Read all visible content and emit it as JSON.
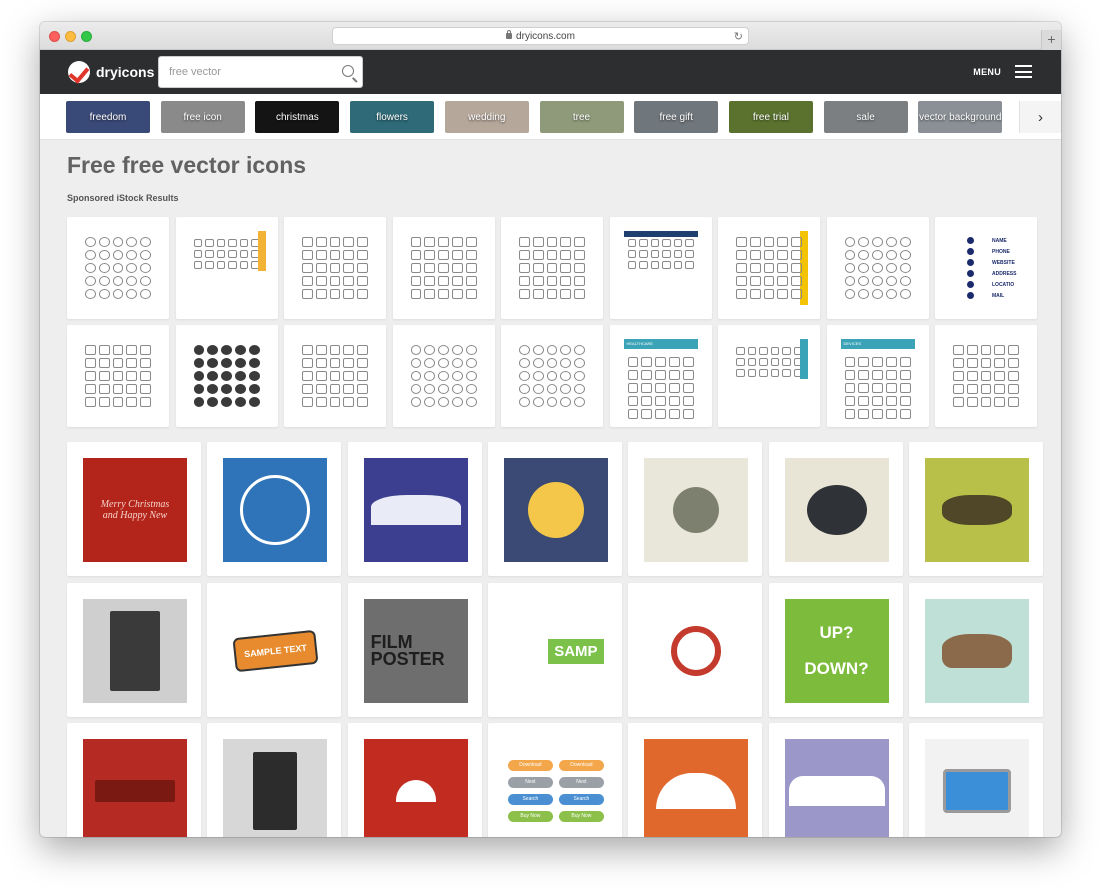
{
  "browser": {
    "url": "dryicons.com"
  },
  "header": {
    "logo_text": "dryicons",
    "search_placeholder": "free vector",
    "menu_label": "MENU"
  },
  "tags": [
    {
      "label": "freedom",
      "color": "#3a4a78"
    },
    {
      "label": "free icon",
      "color": "#8a8a8a"
    },
    {
      "label": "christmas",
      "color": "#141414"
    },
    {
      "label": "flowers",
      "color": "#2e6a77"
    },
    {
      "label": "wedding",
      "color": "#b5a79a"
    },
    {
      "label": "tree",
      "color": "#8f9a7a"
    },
    {
      "label": "free gift",
      "color": "#70777c"
    },
    {
      "label": "free trial",
      "color": "#5a722e"
    },
    {
      "label": "sale",
      "color": "#7b7f82"
    },
    {
      "label": "vector background",
      "color": "#8a9096"
    }
  ],
  "tags_next_icon": "chevron-right-icon",
  "main": {
    "title": "Free free vector icons",
    "sponsored_label": "Sponsored iStock Results"
  },
  "sponsored_cards": {
    "row1": [
      {
        "style": "round",
        "icon": "globe-icons"
      },
      {
        "style": "small",
        "icon": "weather-icons",
        "accent": "#f2b233"
      },
      {
        "style": "line",
        "icon": "presentation-icons"
      },
      {
        "style": "line",
        "icon": "people-icons"
      },
      {
        "style": "line",
        "icon": "search-icons"
      },
      {
        "style": "small",
        "icon": "infographic-icons",
        "accent": "#1f3f6e"
      },
      {
        "style": "line",
        "icon": "business-icons",
        "accent": "#f3c200"
      },
      {
        "style": "round",
        "icon": "rocket-icons"
      },
      {
        "style": "contact",
        "icon": "contact-icons",
        "labels": [
          "NAME",
          "PHONE",
          "WEBSITE",
          "ADDRESS",
          "LOCATIO",
          "MAIL"
        ]
      }
    ],
    "row2": [
      {
        "style": "line",
        "icon": "document-icons"
      },
      {
        "style": "solid",
        "icon": "clock-icons"
      },
      {
        "style": "line",
        "icon": "family-icons"
      },
      {
        "style": "round",
        "icon": "thumbs-icons"
      },
      {
        "style": "round",
        "icon": "alarm-icons"
      },
      {
        "style": "line",
        "icon": "healthcare-icons",
        "header": "HEALTHCARE",
        "accent": "#3aa3b8"
      },
      {
        "style": "small",
        "icon": "media-icons",
        "accent": "#3aa3b8"
      },
      {
        "style": "line",
        "icon": "devices-icons",
        "header": "DEVICES",
        "accent": "#3aa3b8"
      },
      {
        "style": "line",
        "icon": "misc-icons"
      }
    ]
  },
  "vector_cards": {
    "row1": [
      {
        "name": "christmas-ornament-vector",
        "text": "Merry Christmas and Happy New",
        "bg": "#b3241b"
      },
      {
        "name": "blue-winter-swirl-vector",
        "text": "",
        "bg": "#2f74b8"
      },
      {
        "name": "snowy-trees-vector",
        "text": "",
        "bg": "#3c3f8f"
      },
      {
        "name": "yellow-floral-vector",
        "text": "",
        "bg": "#3a4a74"
      },
      {
        "name": "grey-flowers-vector",
        "text": "",
        "bg": "#e9e6da"
      },
      {
        "name": "skull-halftone-vector",
        "text": "",
        "bg": "#e8e4d6"
      },
      {
        "name": "shoes-grid-vector",
        "text": "",
        "bg": "#b9c04a"
      }
    ],
    "row2": [
      {
        "name": "city-buildings-vector",
        "text": "",
        "bg": "#cfcfcf"
      },
      {
        "name": "sample-text-banner-vector",
        "text": "SAMPLE TEXT",
        "bg": "#ffffff"
      },
      {
        "name": "film-poster-vector",
        "text": "FILM POSTER",
        "bg": "#6e6e6e"
      },
      {
        "name": "circles-banner-vector",
        "text": "SAMP",
        "bg": "#ffffff"
      },
      {
        "name": "headphones-vector",
        "text": "",
        "bg": "#ffffff"
      },
      {
        "name": "elevator-sign-vector",
        "text": "UP? DOWN?",
        "bg": "#7dbb3c"
      },
      {
        "name": "retro-car-vector",
        "text": "",
        "bg": "#bfe0d7"
      }
    ],
    "row3": [
      {
        "name": "red-grunge-vector",
        "text": "",
        "bg": "#b52a22"
      },
      {
        "name": "construction-vector",
        "text": "",
        "bg": "#d7d7d7"
      },
      {
        "name": "girl-umbrella-vector",
        "text": "",
        "bg": "#c22b20"
      },
      {
        "name": "web-buttons-vector",
        "text": "",
        "bg": "#ffffff",
        "buttons": [
          "Download",
          "Next",
          "Search",
          "Buy Now"
        ]
      },
      {
        "name": "orange-umbrella-vector",
        "text": "",
        "bg": "#e0682d"
      },
      {
        "name": "party-crowd-vector",
        "text": "",
        "bg": "#9b98c9"
      },
      {
        "name": "laptop-vector",
        "text": "",
        "bg": "#f2f2f2"
      }
    ]
  }
}
